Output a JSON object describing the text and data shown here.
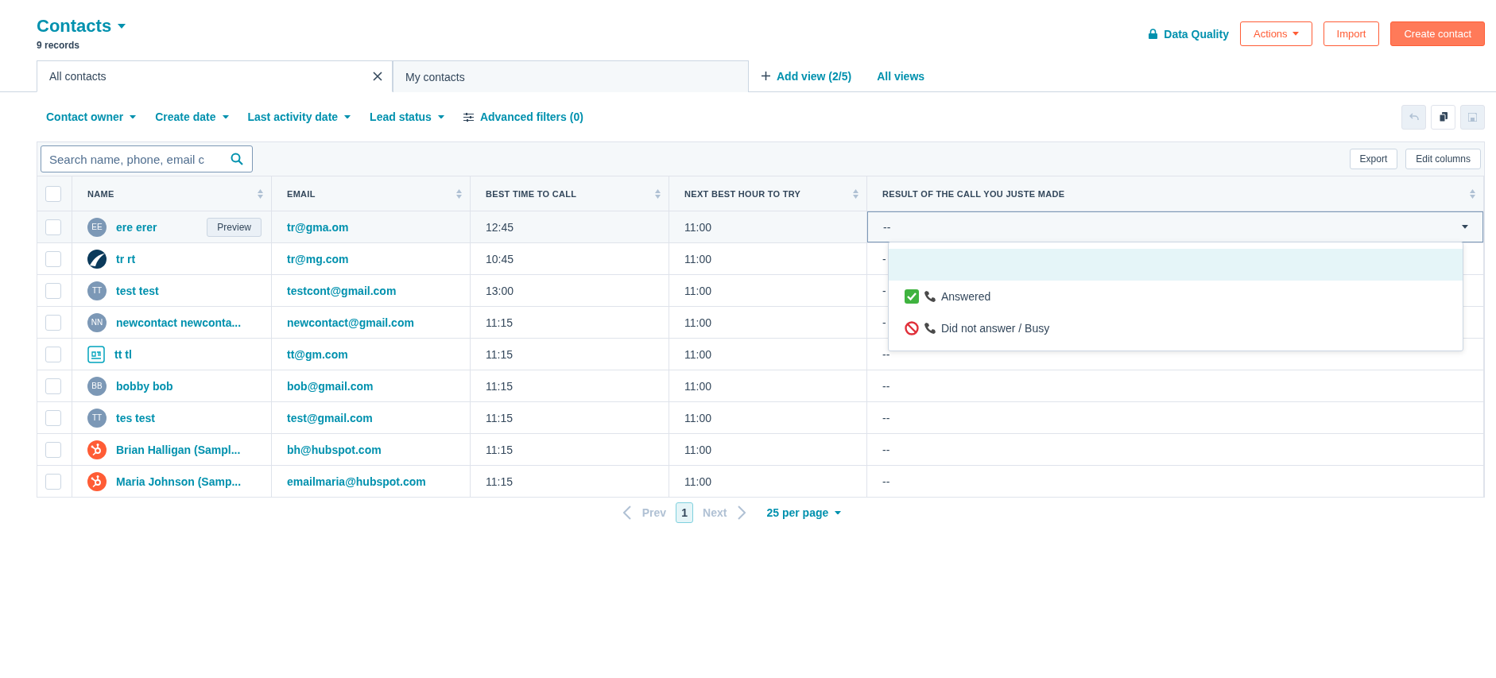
{
  "header": {
    "title": "Contacts",
    "record_count": "9 records",
    "data_quality": "Data Quality",
    "buttons": [
      {
        "kind": "menu",
        "label": "Actions"
      },
      {
        "kind": "outline",
        "label": "Import"
      },
      {
        "kind": "primary",
        "label": "Create contact"
      }
    ]
  },
  "view_tabs": [
    {
      "label": "All contacts",
      "selected": true
    },
    {
      "label": "My contacts",
      "selected": false
    }
  ],
  "select_all_checked": false,
  "add_view": "Add view (2/5)",
  "all_views": "All views",
  "filters": [
    {
      "kind": "dropdown",
      "label": "Contact owner"
    },
    {
      "kind": "dropdown",
      "label": "Create date"
    },
    {
      "kind": "dropdown",
      "label": "Last activity date"
    },
    {
      "kind": "dropdown",
      "label": "Lead status"
    },
    {
      "kind": "advanced",
      "label": "Advanced filters (0)"
    }
  ],
  "view_actions": [
    {
      "kind": "undo",
      "disabled": true
    },
    {
      "kind": "copy",
      "disabled": false
    },
    {
      "kind": "save",
      "disabled": true
    }
  ],
  "search": {
    "placeholder": "Search name, phone, email c"
  },
  "table_buttons": [
    "Export",
    "Edit columns"
  ],
  "columns": [
    "NAME",
    "EMAIL",
    "BEST TIME TO CALL",
    "NEXT BEST HOUR TO TRY",
    "RESULT OF THE CALL YOU JUSTE MADE"
  ],
  "rows": [
    {
      "avatar": {
        "kind": "initials",
        "text": "EE"
      },
      "name": "ere erer",
      "preview": "Preview",
      "email": "tr@gma.om",
      "best_time": "12:45",
      "next_hour": "11:00",
      "result": "--",
      "checked": false,
      "editing": true
    },
    {
      "avatar": {
        "kind": "swoosh"
      },
      "name": "tr rt",
      "email": "tr@mg.com",
      "best_time": "10:45",
      "next_hour": "11:00",
      "result": "-",
      "checked": false,
      "editing": false
    },
    {
      "avatar": {
        "kind": "initials",
        "text": "TT"
      },
      "name": "test test",
      "email": "testcont@gmail.com",
      "best_time": "13:00",
      "next_hour": "11:00",
      "result": "-",
      "checked": false,
      "editing": false
    },
    {
      "avatar": {
        "kind": "initials",
        "text": "NN"
      },
      "name": "newcontact newconta...",
      "email": "newcontact@gmail.com",
      "best_time": "11:15",
      "next_hour": "11:00",
      "result": "-",
      "checked": false,
      "editing": false
    },
    {
      "avatar": {
        "kind": "badge"
      },
      "name": "tt tl",
      "email": "tt@gm.com",
      "best_time": "11:15",
      "next_hour": "11:00",
      "result": "--",
      "checked": false,
      "editing": false
    },
    {
      "avatar": {
        "kind": "initials",
        "text": "BB"
      },
      "name": "bobby bob",
      "email": "bob@gmail.com",
      "best_time": "11:15",
      "next_hour": "11:00",
      "result": "--",
      "checked": false,
      "editing": false
    },
    {
      "avatar": {
        "kind": "initials",
        "text": "TT"
      },
      "name": "tes test",
      "email": "test@gmail.com",
      "best_time": "11:15",
      "next_hour": "11:00",
      "result": "--",
      "checked": false,
      "editing": false
    },
    {
      "avatar": {
        "kind": "sprocket"
      },
      "name": "Brian Halligan (Sampl...",
      "email": "bh@hubspot.com",
      "best_time": "11:15",
      "next_hour": "11:00",
      "result": "--",
      "checked": false,
      "editing": false
    },
    {
      "avatar": {
        "kind": "sprocket"
      },
      "name": "Maria Johnson (Samp...",
      "email": "emailmaria@hubspot.com",
      "best_time": "11:15",
      "next_hour": "11:00",
      "result": "--",
      "checked": false,
      "editing": false
    }
  ],
  "dropdown": {
    "options": [
      {
        "kind": "empty",
        "highlighted": true
      },
      {
        "kind": "answered",
        "label": "Answered",
        "highlighted": false
      },
      {
        "kind": "busy",
        "label": "Did not answer / Busy",
        "highlighted": false
      }
    ]
  },
  "pagination": {
    "prev": "Prev",
    "page": "1",
    "next": "Next",
    "per_page": "25 per page"
  }
}
